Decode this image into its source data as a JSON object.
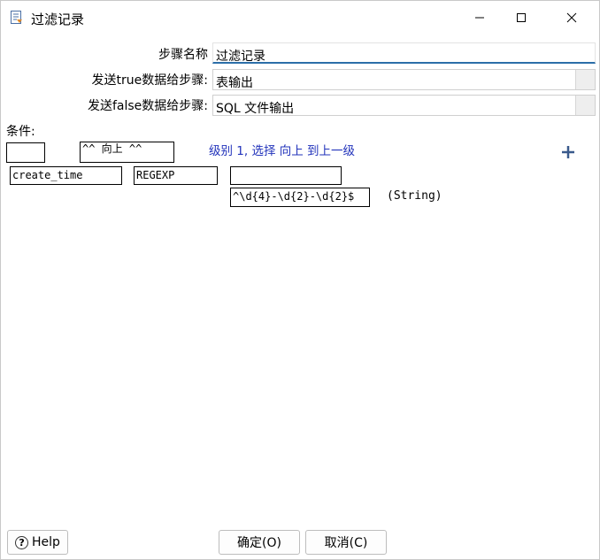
{
  "window": {
    "title": "过滤记录",
    "icons": [
      "filter-step-icon",
      "minimize-icon",
      "maximize-icon",
      "close-icon"
    ]
  },
  "form": {
    "step_name_label": "步骤名称",
    "step_name_value": "过滤记录",
    "send_true_label": "发送true数据给步骤:",
    "send_true_value": "表输出",
    "send_false_label": "发送false数据给步骤:",
    "send_false_value": "SQL 文件输出"
  },
  "condition": {
    "label": "条件:",
    "negate_box": "",
    "up_button": "^^ 向上 ^^",
    "level_text": "级别 1, 选择 向上 到上一级",
    "add_icon": "plus-icon",
    "field_name": "create_time",
    "operator": "REGEXP",
    "compare_field": "",
    "compare_value": "^\\d{4}-\\d{2}-\\d{2}$",
    "value_type": "(String)"
  },
  "buttons": {
    "help": "Help",
    "ok": "确定(O)",
    "cancel": "取消(C)"
  },
  "colors": {
    "accent_underline": "#2b6ea8",
    "link_text": "#2233bb",
    "add_icon": "#3a5a8c"
  }
}
